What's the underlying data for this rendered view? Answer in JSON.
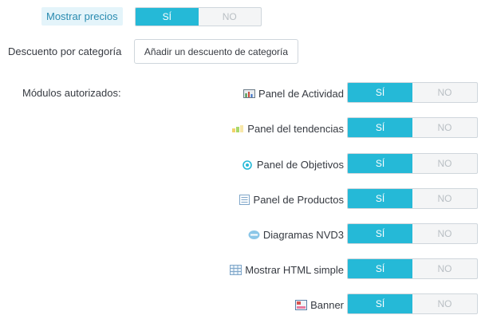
{
  "show_prices": {
    "label": "Mostrar precios",
    "yes": "SÍ",
    "no": "NO",
    "value": "yes"
  },
  "discount": {
    "label": "Descuento por categoría",
    "button": "Añadir un descuento de categoría"
  },
  "modules": {
    "label": "Módulos autorizados:",
    "items": [
      {
        "name": "Panel de Actividad",
        "icon": "activity-chart-icon",
        "yes": "SÍ",
        "no": "NO",
        "value": "yes"
      },
      {
        "name": "Panel del tendencias",
        "icon": "trends-icon",
        "yes": "SÍ",
        "no": "NO",
        "value": "yes"
      },
      {
        "name": "Panel de Objetivos",
        "icon": "target-icon",
        "yes": "SÍ",
        "no": "NO",
        "value": "yes"
      },
      {
        "name": "Panel de Productos",
        "icon": "list-icon",
        "yes": "SÍ",
        "no": "NO",
        "value": "yes"
      },
      {
        "name": "Diagramas NVD3",
        "icon": "chart-badge-icon",
        "yes": "SÍ",
        "no": "NO",
        "value": "yes"
      },
      {
        "name": "Mostrar HTML simple",
        "icon": "grid-icon",
        "yes": "SÍ",
        "no": "NO",
        "value": "yes"
      },
      {
        "name": "Banner",
        "icon": "banner-icon",
        "yes": "SÍ",
        "no": "NO",
        "value": "yes"
      }
    ]
  },
  "colors": {
    "accent": "#25b9d7",
    "label_bg": "#e4f4fa",
    "label_text": "#2a8bb0"
  }
}
